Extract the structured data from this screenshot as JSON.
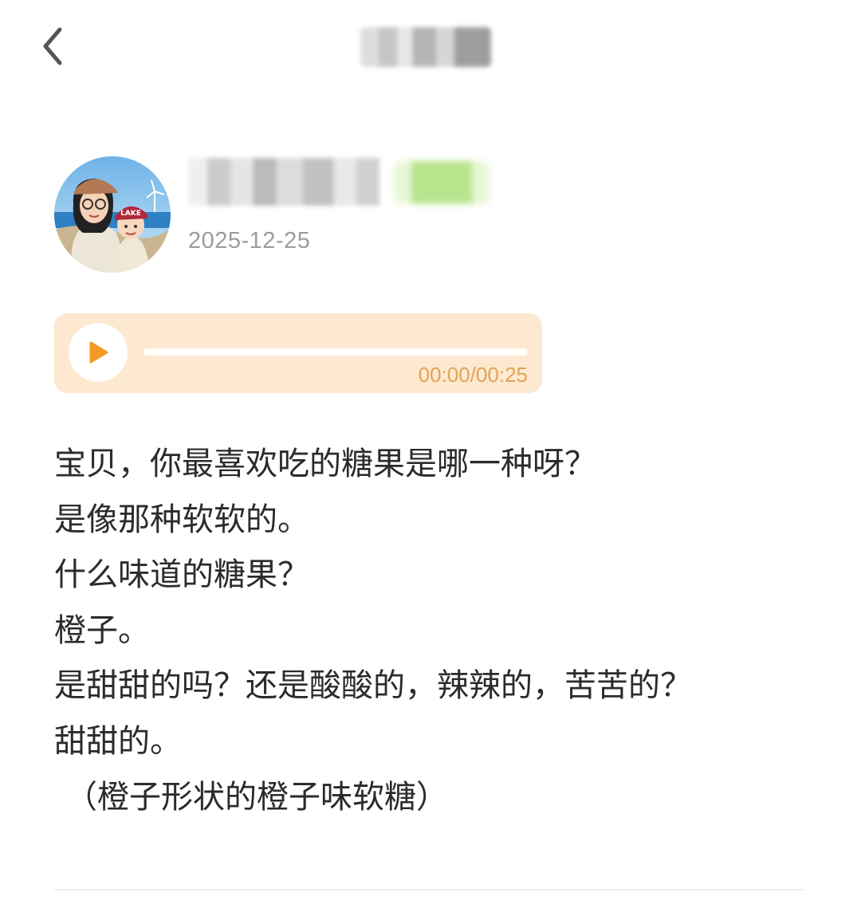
{
  "header": {
    "back_icon": "chevron-left-icon",
    "title": ""
  },
  "author": {
    "name": "",
    "date": "2025-12-25"
  },
  "audio": {
    "time": "00:00/00:25",
    "progress": 0,
    "play_icon": "play-icon",
    "accent_color": "#f39a26",
    "background_color": "#fde9cf"
  },
  "post": {
    "lines": [
      "宝贝，你最喜欢吃的糖果是哪一种呀？",
      "是像那种软软的。",
      "什么味道的糖果？",
      "橙子。",
      "是甜甜的吗？还是酸酸的，辣辣的，苦苦的？",
      "甜甜的。",
      "（橙子形状的橙子味软糖）"
    ]
  }
}
